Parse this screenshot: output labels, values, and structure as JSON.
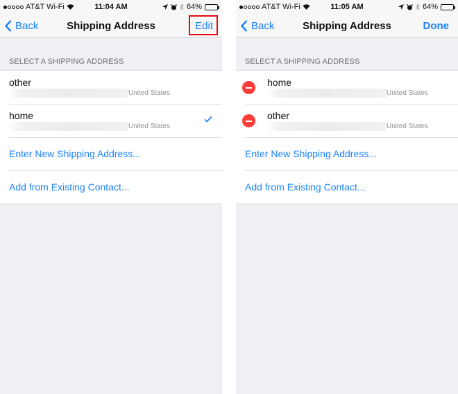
{
  "colors": {
    "accent": "#1a82fb",
    "delete": "#fc3d39",
    "highlight": "#e50914",
    "background": "#efeff4"
  },
  "screens": [
    {
      "status": {
        "carrier": "AT&T Wi-Fi",
        "signal_dots_filled": 1,
        "signal_dots_total": 5,
        "time": "11:04 AM",
        "battery": "64%",
        "battery_level": 0.64
      },
      "nav": {
        "back": "Back",
        "title": "Shipping Address",
        "action": "Edit"
      },
      "section_header": "SELECT A SHIPPING ADDRESS",
      "addresses": [
        {
          "name": "other",
          "country": "United States",
          "selected": false
        },
        {
          "name": "home",
          "country": "United States",
          "selected": true
        }
      ],
      "links": [
        "Enter New Shipping Address...",
        "Add from Existing Contact..."
      ]
    },
    {
      "status": {
        "carrier": "AT&T Wi-Fi",
        "signal_dots_filled": 1,
        "signal_dots_total": 5,
        "time": "11:05 AM",
        "battery": "64%",
        "battery_level": 0.64
      },
      "nav": {
        "back": "Back",
        "title": "Shipping Address",
        "action": "Done"
      },
      "section_header": "SELECT A SHIPPING ADDRESS",
      "addresses": [
        {
          "name": "home",
          "country": "United States"
        },
        {
          "name": "other",
          "country": "United States"
        }
      ],
      "links": [
        "Enter New Shipping Address...",
        "Add from Existing Contact..."
      ]
    }
  ]
}
